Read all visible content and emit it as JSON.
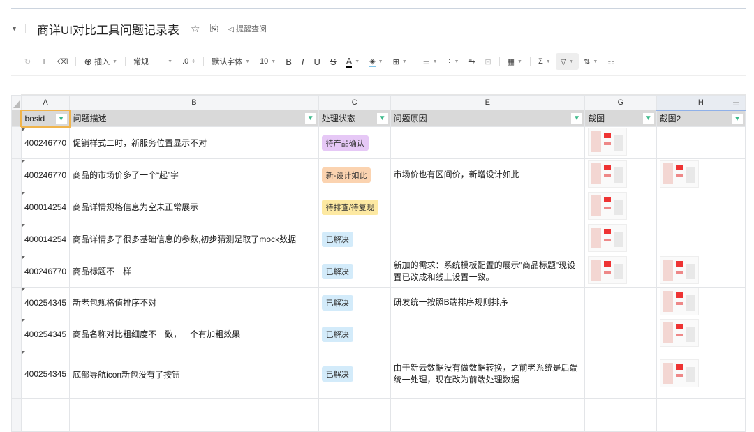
{
  "title": "商详UI对比工具问题记录表",
  "remind_label": "提醒查阅",
  "toolbar": {
    "insert": "插入",
    "format": "常规",
    "decimal": ".0",
    "font": "默认字体",
    "size": "10",
    "bold": "B",
    "italic": "I",
    "underline": "U",
    "strike": "S",
    "font_color": "A"
  },
  "columns": [
    "A",
    "B",
    "C",
    "E",
    "G",
    "H"
  ],
  "headers": [
    "bosid",
    "问题描述",
    "处理状态",
    "问题原因",
    "截图",
    "截图2"
  ],
  "colors": {
    "purple": "#e6c8f6",
    "orange": "#fbd3b0",
    "yellow": "#fde9a2",
    "blue": "#d3ebfa"
  },
  "rows": [
    {
      "id": "400246770",
      "desc": "促销样式二时，新服务位置显示不对",
      "status": "待产品确认",
      "status_color": "purple",
      "reason": "",
      "g": true,
      "h": false
    },
    {
      "id": "400246770",
      "desc": "商品的市场价多了一个“起”字",
      "status": "新-设计如此",
      "status_color": "orange",
      "reason": "市场价也有区间价，新增设计如此",
      "g": true,
      "h": true
    },
    {
      "id": "400014254",
      "desc": "商品详情规格信息为空未正常展示",
      "status": "待排查/待复现",
      "status_color": "yellow",
      "reason": "",
      "g": true,
      "h": false
    },
    {
      "id": "400014254",
      "desc": "商品详情多了很多基础信息的参数,初步猜测是取了mock数据",
      "status": "已解决",
      "status_color": "blue",
      "reason": "",
      "g": true,
      "h": false
    },
    {
      "id": "400246770",
      "desc": "商品标题不一样",
      "status": "已解决",
      "status_color": "blue",
      "reason": "新加的需求：系统模板配置的展示\"商品标题\"现设置已改成和线上设置一致。",
      "g": true,
      "h": true
    },
    {
      "id": "400254345",
      "desc": "新老包规格值排序不对",
      "status": "已解决",
      "status_color": "blue",
      "reason": "研发统一按照B端排序规则排序",
      "g": false,
      "h": true
    },
    {
      "id": "400254345",
      "desc": "商品名称对比粗细度不一致，一个有加粗效果",
      "status": "已解决",
      "status_color": "blue",
      "reason": "",
      "g": false,
      "h": true
    },
    {
      "id": "400254345",
      "desc": "底部导航icon新包没有了按钮",
      "status": "已解决",
      "status_color": "blue",
      "reason": "由于新云数据没有做数据转换，之前老系统是后端统一处理，现在改为前端处理数据",
      "g": false,
      "h": true
    }
  ]
}
